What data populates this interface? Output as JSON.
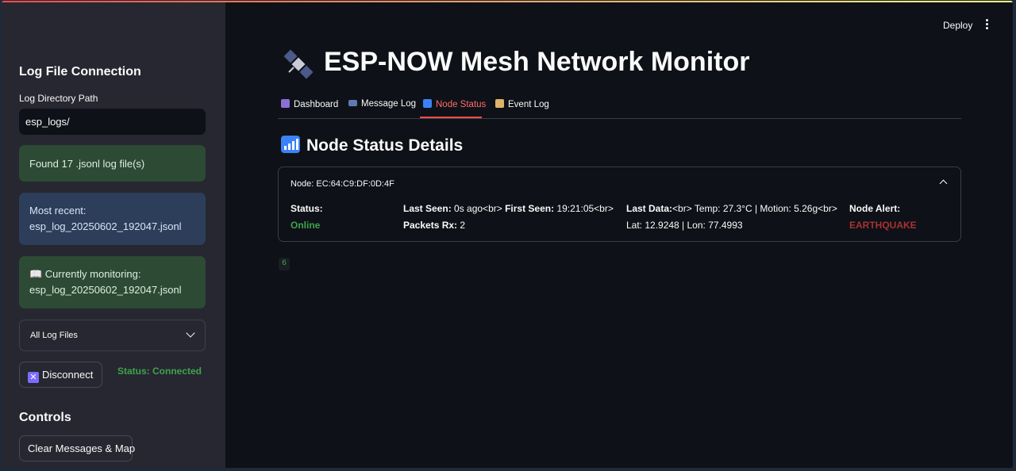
{
  "sidebar": {
    "heading_connection": "Log File Connection",
    "dir_label": "Log Directory Path",
    "dir_value": "esp_logs/",
    "found_msg": "Found 17 .jsonl log file(s)",
    "most_recent_label": "Most recent:",
    "most_recent_file": "esp_log_20250602_192047.jsonl",
    "monitoring_label": "📖 Currently monitoring:",
    "monitoring_file": "esp_log_20250602_192047.jsonl",
    "select_value": "All Log Files",
    "disconnect_label": "Disconnect",
    "status_text": "Status: Connected",
    "heading_controls": "Controls",
    "clear_label": "Clear Messages & Map"
  },
  "header": {
    "deploy_label": "Deploy",
    "title": "ESP-NOW Mesh Network Monitor"
  },
  "tabs": [
    {
      "label": "Dashboard",
      "icon": "chart-icon"
    },
    {
      "label": "Message Log",
      "icon": "envelope-icon"
    },
    {
      "label": "Node Status",
      "icon": "signal-icon",
      "active": true
    },
    {
      "label": "Event Log",
      "icon": "scroll-icon"
    }
  ],
  "section": {
    "title": "Node Status Details"
  },
  "node": {
    "header": "Node: EC:64:C9:DF:0D:4F",
    "status_label": "Status:",
    "status_value": "Online",
    "last_seen_label": "Last Seen:",
    "last_seen_value": "0s ago<br>",
    "first_seen_label": "First Seen:",
    "first_seen_value": "19:21:05<br>",
    "packets_label": "Packets Rx:",
    "packets_value": "2",
    "last_data_label": "Last Data:",
    "last_data_value": "<br> Temp: 27.3°C | Motion: 5.26g<br>",
    "latlon_value": "Lat: 12.9248 | Lon: 77.4993",
    "alert_label": "Node Alert:",
    "alert_value": "EARTHQUAKE"
  },
  "misc": {
    "small_badge": "6"
  },
  "colors": {
    "accent": "#ff4b4b",
    "online": "#3fa34d",
    "alert": "#a83232"
  }
}
